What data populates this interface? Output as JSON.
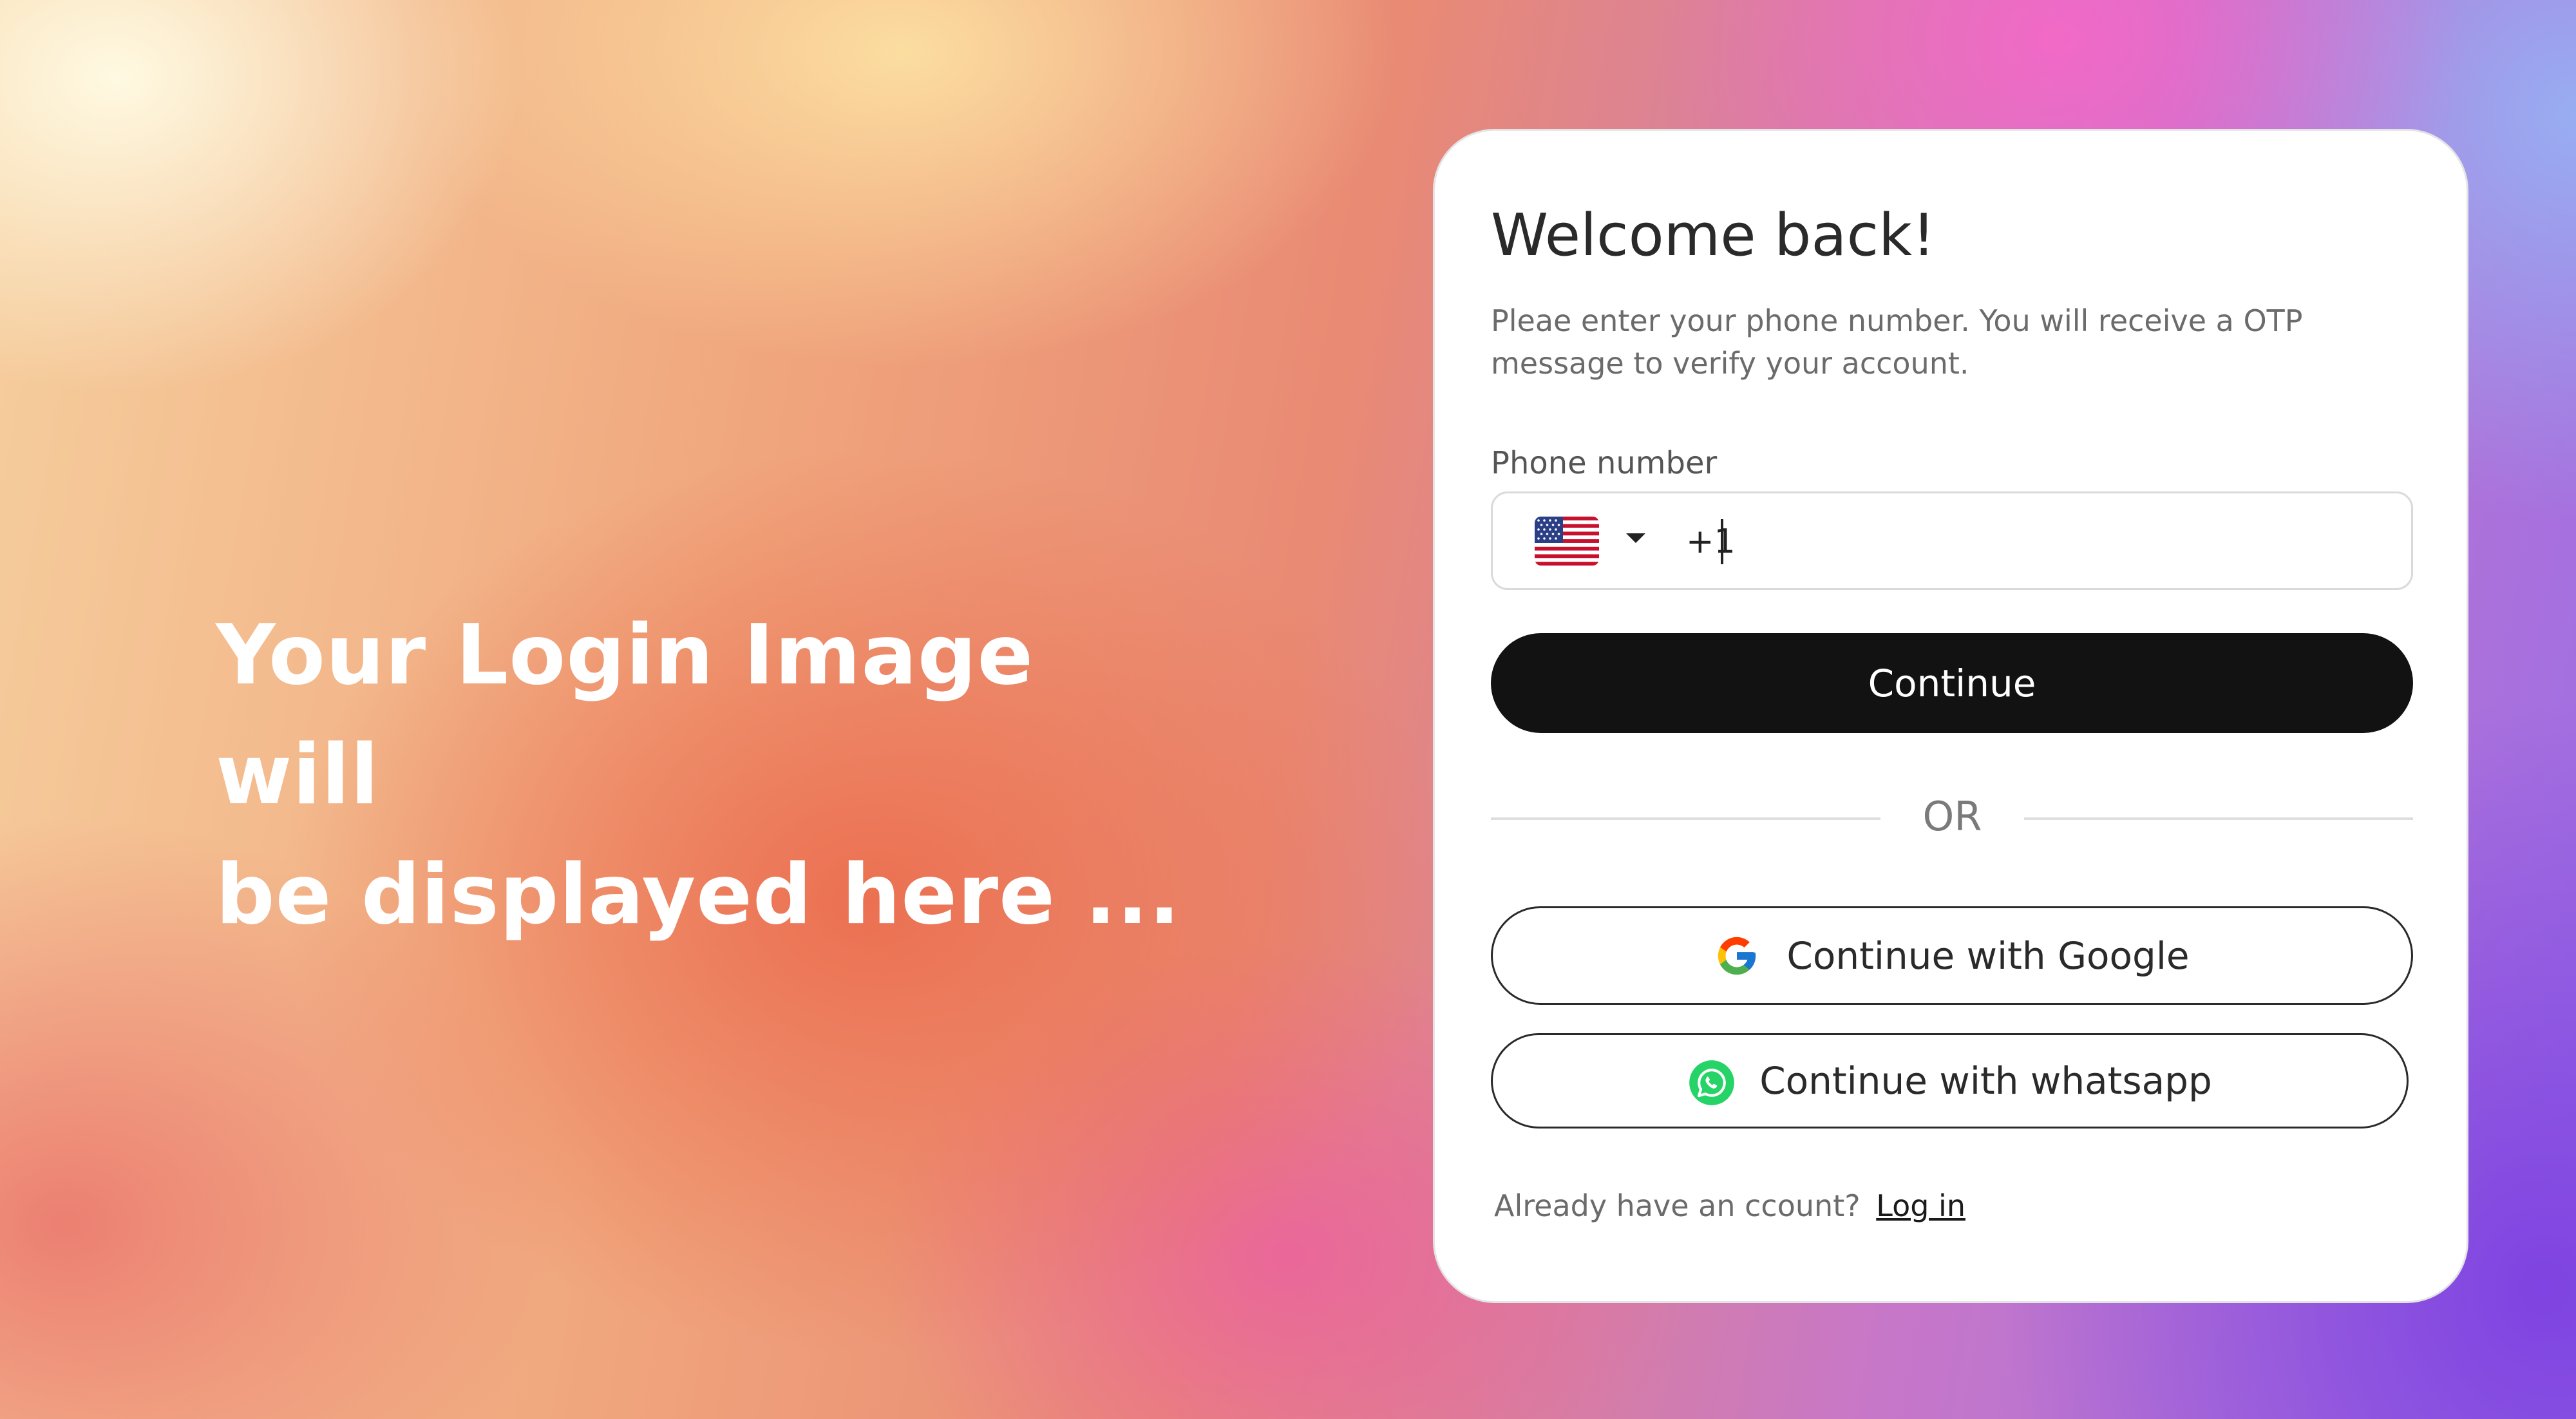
{
  "hero": {
    "line1": "Your Login Image will",
    "line2": "be displayed here ..."
  },
  "card": {
    "title": "Welcome back!",
    "subtitle": "Pleae enter your phone number. You will receive a OTP message to verify your account.",
    "phone": {
      "label": "Phone number",
      "country_icon": "us-flag-icon",
      "value": "+1"
    },
    "continue_label": "Continue",
    "divider_text": "OR",
    "google_label": "Continue with Google",
    "whatsapp_label": "Continue with whatsapp",
    "footer": {
      "prompt": "Already have an ccount?",
      "login_link": "Log in"
    }
  },
  "colors": {
    "primary_button": "#121212",
    "card_background": "#ffffff",
    "whatsapp_green": "#25d366"
  }
}
